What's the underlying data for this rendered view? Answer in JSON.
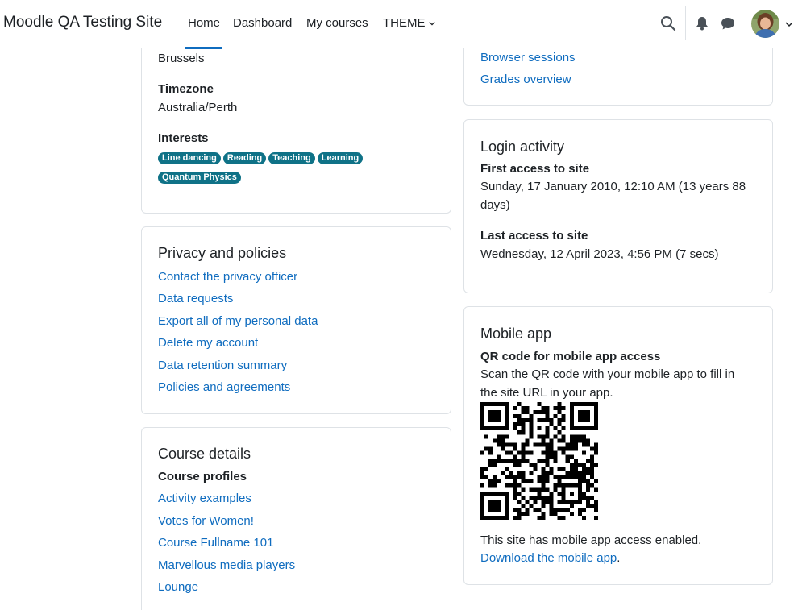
{
  "navbar": {
    "brand": "Moodle QA Testing Site",
    "items": [
      {
        "label": "Home",
        "active": true
      },
      {
        "label": "Dashboard"
      },
      {
        "label": "My courses"
      },
      {
        "label": "THEME"
      }
    ],
    "icons": [
      "search-icon",
      "bell-icon",
      "chat-icon",
      "chevron-down-icon"
    ],
    "accent": "#0f6cbf"
  },
  "profile": {
    "city": "Brussels",
    "timezone_label": "Timezone",
    "timezone": "Australia/Perth",
    "interests_label": "Interests",
    "interests": [
      "Line dancing",
      "Reading",
      "Teaching",
      "Learning",
      "Quantum Physics"
    ],
    "tag_color": "#0f7287"
  },
  "privacy": {
    "title": "Privacy and policies",
    "links": [
      "Contact the privacy officer",
      "Data requests",
      "Export all of my personal data",
      "Delete my account",
      "Data retention summary",
      "Policies and agreements"
    ]
  },
  "course_details": {
    "title": "Course details",
    "subtitle": "Course profiles",
    "courses": [
      "Activity examples",
      "Votes for Women!",
      "Course Fullname 101",
      "Marvellous media players",
      "Lounge"
    ]
  },
  "reports": {
    "links": [
      "Browser sessions",
      "Grades overview"
    ]
  },
  "login_activity": {
    "title": "Login activity",
    "first_label": "First access to site",
    "first_value_line1": "Sunday, 17 January 2010, 12:10 AM  (13 years 88",
    "first_value_line2": "days)",
    "last_label": "Last access to site",
    "last_value": "Wednesday, 12 April 2023, 4:56 PM  (7 secs)"
  },
  "mobile_app": {
    "title": "Mobile app",
    "qr_label": "QR code for mobile app access",
    "instructions_line1": "Scan the QR code with your mobile app to fill in",
    "instructions_line2": "the site URL in your app.",
    "enabled_text": "This site has mobile app access enabled.",
    "download_link": "Download the mobile app",
    "download_suffix": "."
  }
}
